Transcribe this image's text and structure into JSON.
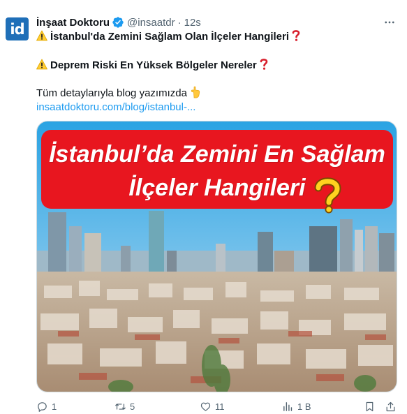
{
  "author": {
    "display_name": "İnşaat Doktoru",
    "handle": "@insaatdr",
    "separator": "·",
    "time": "12s",
    "avatar_text": "id"
  },
  "tweet": {
    "line1": "İstanbul'da Zemini Sağlam Olan İlçeler Hangileri",
    "line2": "Deprem Riski En Yüksek Bölgeler Nereler",
    "line3": "Tüm detaylarıyla blog yazımızda",
    "link": "insaatdoktoru.com/blog/istanbul-..."
  },
  "media": {
    "banner_line1": "İstanbul’da Zemini En Sağlam",
    "banner_line2": "İlçeler Hangileri"
  },
  "actions": {
    "replies": "1",
    "reposts": "5",
    "likes": "11",
    "views": "1 B"
  },
  "colors": {
    "accent": "#1d9bf0",
    "banner_red": "#e8161f",
    "muted": "#536471"
  },
  "icons": [
    "verified-badge-icon",
    "more-icon",
    "warning-icon",
    "question-mark-icon",
    "pointing-down-icon",
    "reply-icon",
    "repost-icon",
    "like-icon",
    "views-icon",
    "bookmark-icon",
    "share-icon"
  ]
}
